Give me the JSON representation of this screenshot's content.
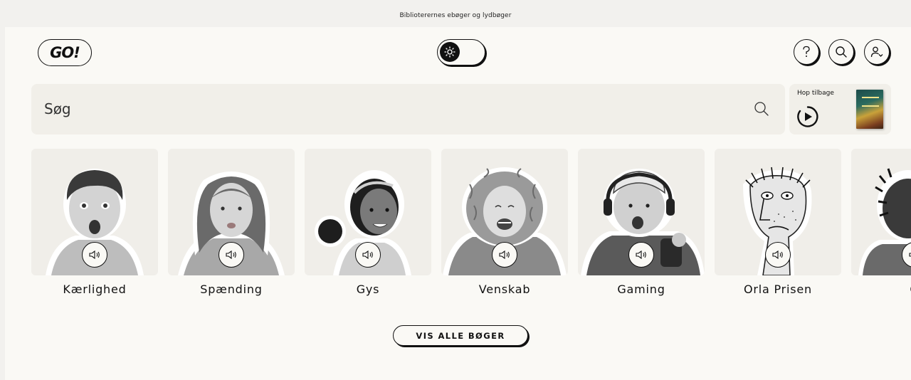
{
  "topbar": {
    "tagline": "Biblioterernes ebøger og lydbøger"
  },
  "header": {
    "logo_text": "GO!",
    "theme_toggle_icon": "sun-icon",
    "help_icon": "question-icon",
    "search_icon": "search-icon",
    "profile_icon": "user-icon"
  },
  "search": {
    "placeholder": "Søg",
    "icon": "search-icon"
  },
  "resume": {
    "label": "Hop tilbage",
    "play_icon": "play-icon"
  },
  "categories": [
    {
      "name": "Kærlighed",
      "icon": "speaker-icon"
    },
    {
      "name": "Spænding",
      "icon": "speaker-icon"
    },
    {
      "name": "Gys",
      "icon": "speaker-icon"
    },
    {
      "name": "Venskab",
      "icon": "speaker-icon"
    },
    {
      "name": "Gaming",
      "icon": "speaker-icon"
    },
    {
      "name": "Orla Prisen",
      "icon": "speaker-icon"
    },
    {
      "name": "G",
      "icon": "speaker-icon"
    }
  ],
  "show_all_label": "VIS ALLE BØGER",
  "colors": {
    "background": "#faf9f5",
    "card": "#f0eee9",
    "ink": "#111111"
  }
}
